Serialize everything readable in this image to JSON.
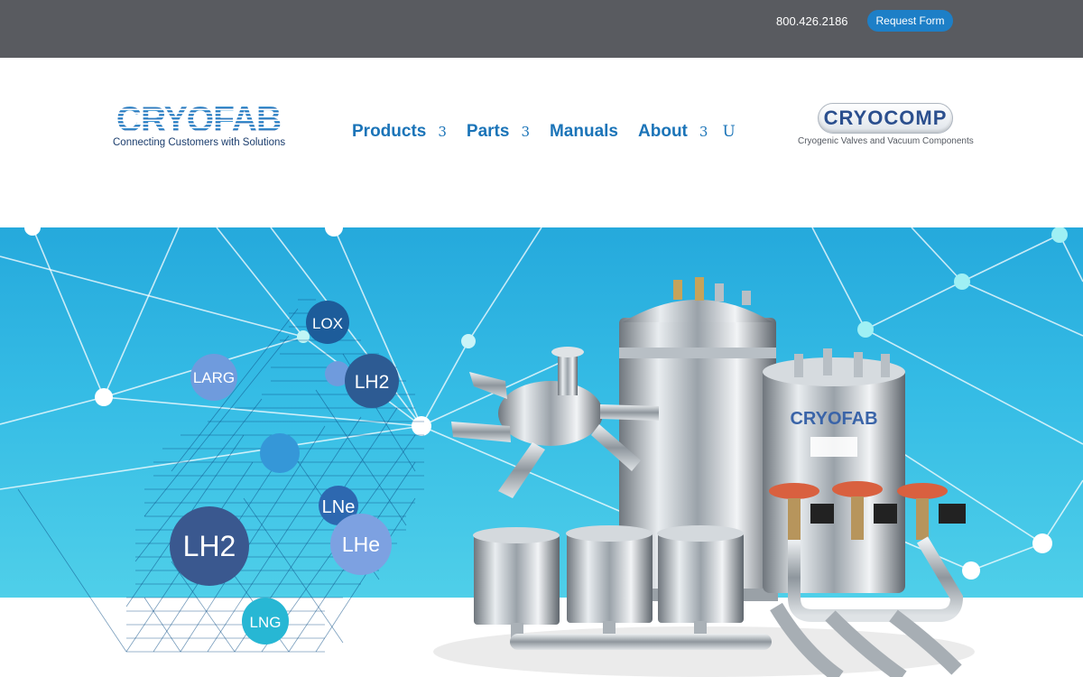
{
  "topbar": {
    "phone": "800.426.2186",
    "request_form_label": "Request Form",
    "background_color": "#595b60",
    "button_color": "#1d7fc7"
  },
  "header": {
    "left_logo": {
      "wordmark": "CRYOFAB",
      "tagline": "Connecting Customers with Solutions"
    },
    "nav": [
      {
        "label": "Products",
        "chevron": "3"
      },
      {
        "label": "Parts",
        "chevron": "3"
      },
      {
        "label": "Manuals",
        "chevron": ""
      },
      {
        "label": "About",
        "chevron": "3"
      }
    ],
    "search_icon_glyph": "U",
    "right_logo": {
      "wordmark": "CRYOCOMP",
      "tagline": "Cryogenic Valves and Vacuum Components"
    },
    "nav_color": "#1b74b8"
  },
  "hero": {
    "bubbles": [
      "LOX",
      "LARG",
      "LH2",
      "LNe",
      "LH2",
      "LHe",
      "LNG"
    ],
    "tank_label": "CRYOFAB",
    "gradient": [
      "#25a9dc",
      "#4fcfe9"
    ]
  }
}
